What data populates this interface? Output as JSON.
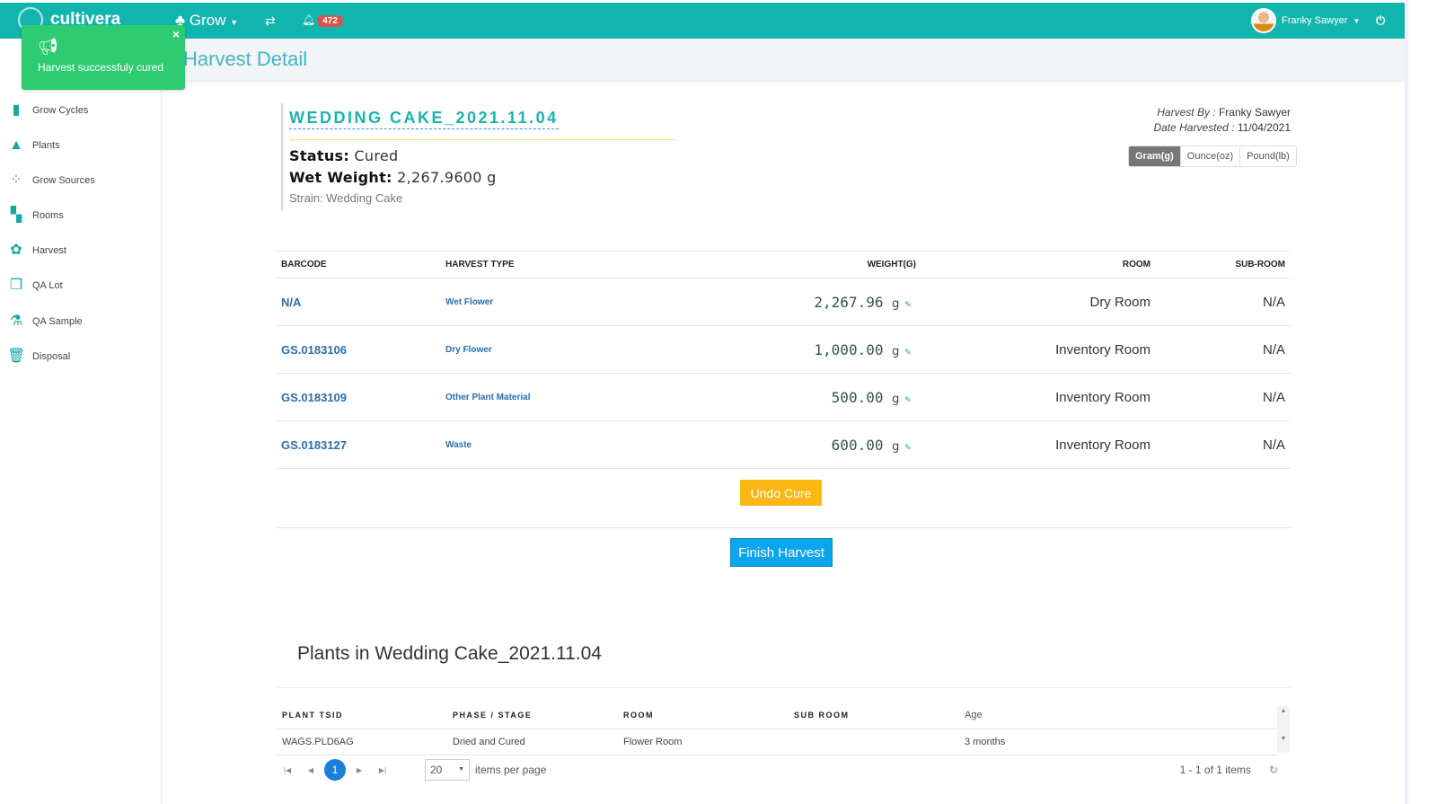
{
  "topbar": {
    "brand": "cultivera",
    "module": "Grow",
    "notifications": "472",
    "user": "Franky Sawyer"
  },
  "toast": {
    "message": "Harvest successfuly cured"
  },
  "page": {
    "title": "Harvest Detail"
  },
  "sidebar": {
    "items": [
      {
        "label": "Grow Cycles",
        "icon": "bar-chart-icon"
      },
      {
        "label": "Plants",
        "icon": "tree-icon"
      },
      {
        "label": "Grow Sources",
        "icon": "dots-icon"
      },
      {
        "label": "Rooms",
        "icon": "grid-icon"
      },
      {
        "label": "Harvest",
        "icon": "flower-icon"
      },
      {
        "label": "QA Lot",
        "icon": "squares-icon"
      },
      {
        "label": "QA Sample",
        "icon": "flask-icon"
      },
      {
        "label": "Disposal",
        "icon": "trash-icon"
      }
    ]
  },
  "harvest": {
    "name": "WEDDING CAKE_2021.11.04",
    "status_label": "Status:",
    "status": "Cured",
    "wet_label": "Wet Weight:",
    "wet": "2,267.9600",
    "wet_unit": "g",
    "strain": "Strain: Wedding Cake",
    "by_label": "Harvest By :",
    "by": "Franky Sawyer",
    "date_label": "Date Harvested :",
    "date": "11/04/2021"
  },
  "units": [
    "Gram(g)",
    "Ounce(oz)",
    "Pound(lb)"
  ],
  "items_table": {
    "headers": [
      "BARCODE",
      "HARVEST TYPE",
      "WEIGHT(G)",
      "ROOM",
      "SUB-ROOM"
    ],
    "rows": [
      {
        "barcode": "N/A",
        "type": "Wet Flower",
        "weight": "2,267.96",
        "unit": "g",
        "room": "Dry Room",
        "sub": "N/A"
      },
      {
        "barcode": "GS.0183106",
        "type": "Dry Flower",
        "weight": "1,000.00",
        "unit": "g",
        "room": "Inventory Room",
        "sub": "N/A"
      },
      {
        "barcode": "GS.0183109",
        "type": "Other Plant Material",
        "weight": "500.00",
        "unit": "g",
        "room": "Inventory Room",
        "sub": "N/A"
      },
      {
        "barcode": "GS.0183127",
        "type": "Waste",
        "weight": "600.00",
        "unit": "g",
        "room": "Inventory Room",
        "sub": "N/A"
      }
    ]
  },
  "actions": {
    "undo": "Undo Cure",
    "finish": "Finish Harvest"
  },
  "plants": {
    "title": "Plants in Wedding Cake_2021.11.04",
    "headers": [
      "PLANT TSID",
      "PHASE / STAGE",
      "ROOM",
      "SUB ROOM",
      "Age"
    ],
    "rows": [
      {
        "tsid": "WAGS.PLD6AG",
        "phase": "Dried and Cured",
        "room": "Flower Room",
        "sub": "",
        "age": "3 months"
      }
    ],
    "page": "1",
    "page_size": "20",
    "per_page_label": "items per page",
    "count": "1 - 1 of 1 items"
  }
}
